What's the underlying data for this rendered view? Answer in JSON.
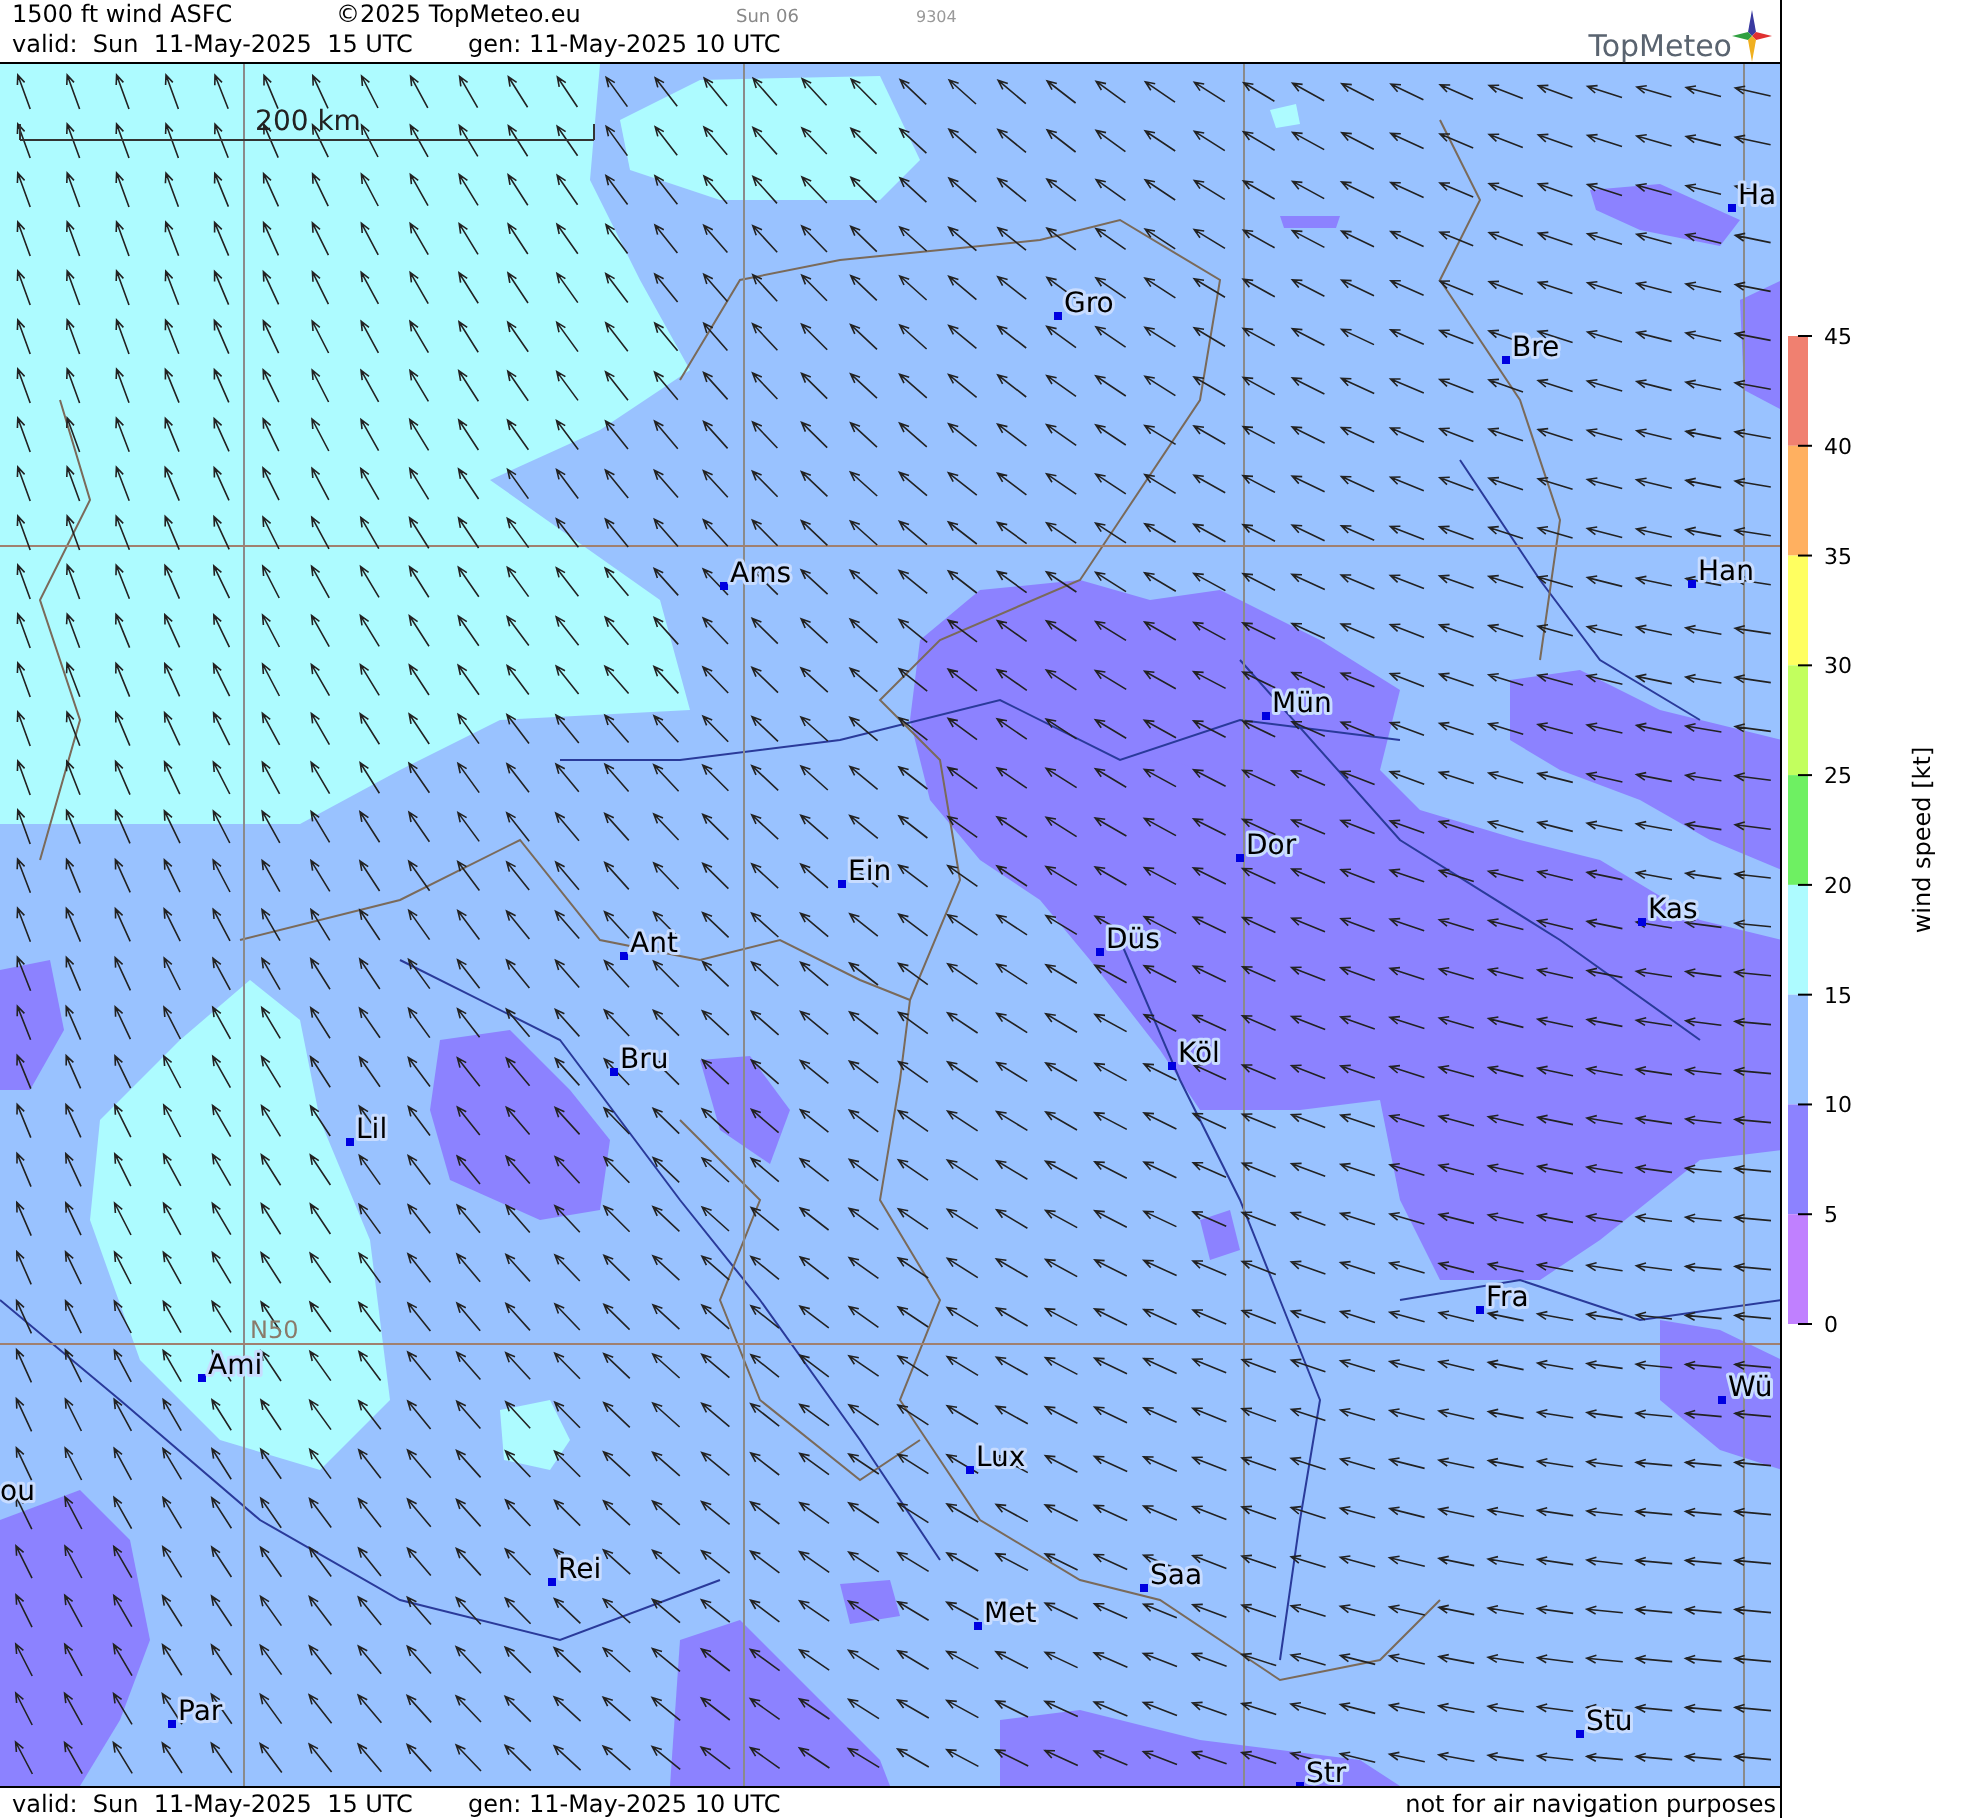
{
  "header": {
    "title": "1500 ft wind ASFC",
    "copyright": "©2025 TopMeteo.eu",
    "run": "Sun 06",
    "code": "9304",
    "valid": "valid:  Sun  11-May-2025  15 UTC",
    "generated": "gen: 11-May-2025 10 UTC",
    "logo": "TopMeteo"
  },
  "map": {
    "scale": "200 km",
    "latitude_label": "N50",
    "cities": [
      {
        "name": "Gro"
      },
      {
        "name": "Bre"
      },
      {
        "name": "Ha"
      },
      {
        "name": "Ams"
      },
      {
        "name": "Han"
      },
      {
        "name": "Mün"
      },
      {
        "name": "Dor"
      },
      {
        "name": "Ein"
      },
      {
        "name": "Kas"
      },
      {
        "name": "Ant"
      },
      {
        "name": "Düs"
      },
      {
        "name": "Bru"
      },
      {
        "name": "Köl"
      },
      {
        "name": "Lil"
      },
      {
        "name": "Fra"
      },
      {
        "name": "Ami"
      },
      {
        "name": "Wü"
      },
      {
        "name": "Lux"
      },
      {
        "name": "ou"
      },
      {
        "name": "Rei"
      },
      {
        "name": "Saa"
      },
      {
        "name": "Met"
      },
      {
        "name": "Par"
      },
      {
        "name": "Stu"
      },
      {
        "name": "Str"
      }
    ]
  },
  "legend": {
    "label": "wind speed [kt]",
    "ticks": [
      "45",
      "40",
      "35",
      "30",
      "25",
      "20",
      "15",
      "10",
      "5",
      "0"
    ],
    "bands": [
      {
        "color": "#f08070"
      },
      {
        "color": "#ffb060"
      },
      {
        "color": "#ffff60"
      },
      {
        "color": "#c2ff5e"
      },
      {
        "color": "#6ef062"
      },
      {
        "color": "#adfbff"
      },
      {
        "color": "#99c2ff"
      },
      {
        "color": "#8c82ff"
      },
      {
        "color": "#c080ff"
      }
    ]
  },
  "footer": {
    "valid": "valid:  Sun  11-May-2025  15 UTC",
    "generated": "gen: 11-May-2025 10 UTC",
    "disclaimer": "not for air navigation purposes"
  }
}
